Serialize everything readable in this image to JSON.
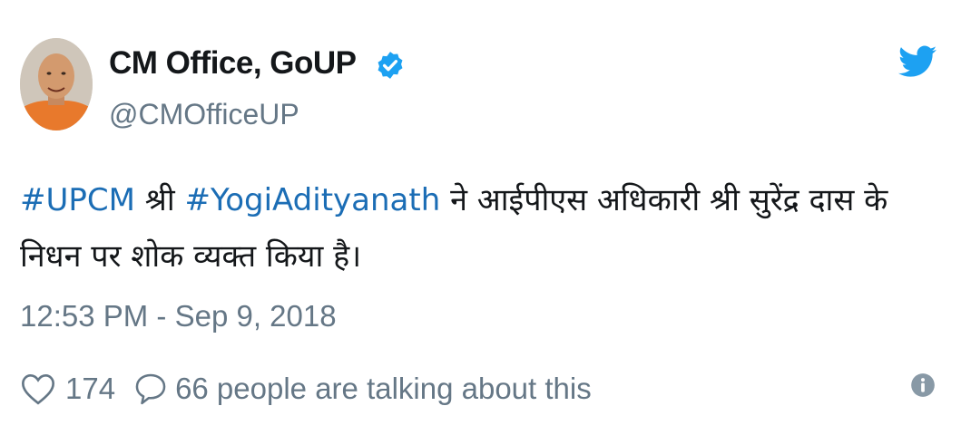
{
  "tweet": {
    "author_name": "CM Office, GoUP",
    "handle": "@CMOfficeUP",
    "verified": true,
    "text_parts": {
      "h1": "#UPCM",
      "t1": " श्री ",
      "h2": "#YogiAdityanath",
      "t2": " ने आईपीएस अधिकारी श्री सुरेंद्र दास के निधन पर शोक व्यक्त किया है।"
    },
    "timestamp": "12:53 PM - Sep 9, 2018",
    "likes": "174",
    "talking": "66 people are talking about this"
  },
  "colors": {
    "hashtag": "#1b6db5",
    "verified": "#1da1f2",
    "twitter_bird": "#1da1f2",
    "muted_text": "#657786"
  },
  "icons": {
    "verified": "verified-badge-icon",
    "logo": "twitter-bird-icon",
    "like": "heart-icon",
    "reply": "comment-icon",
    "info": "info-icon"
  }
}
